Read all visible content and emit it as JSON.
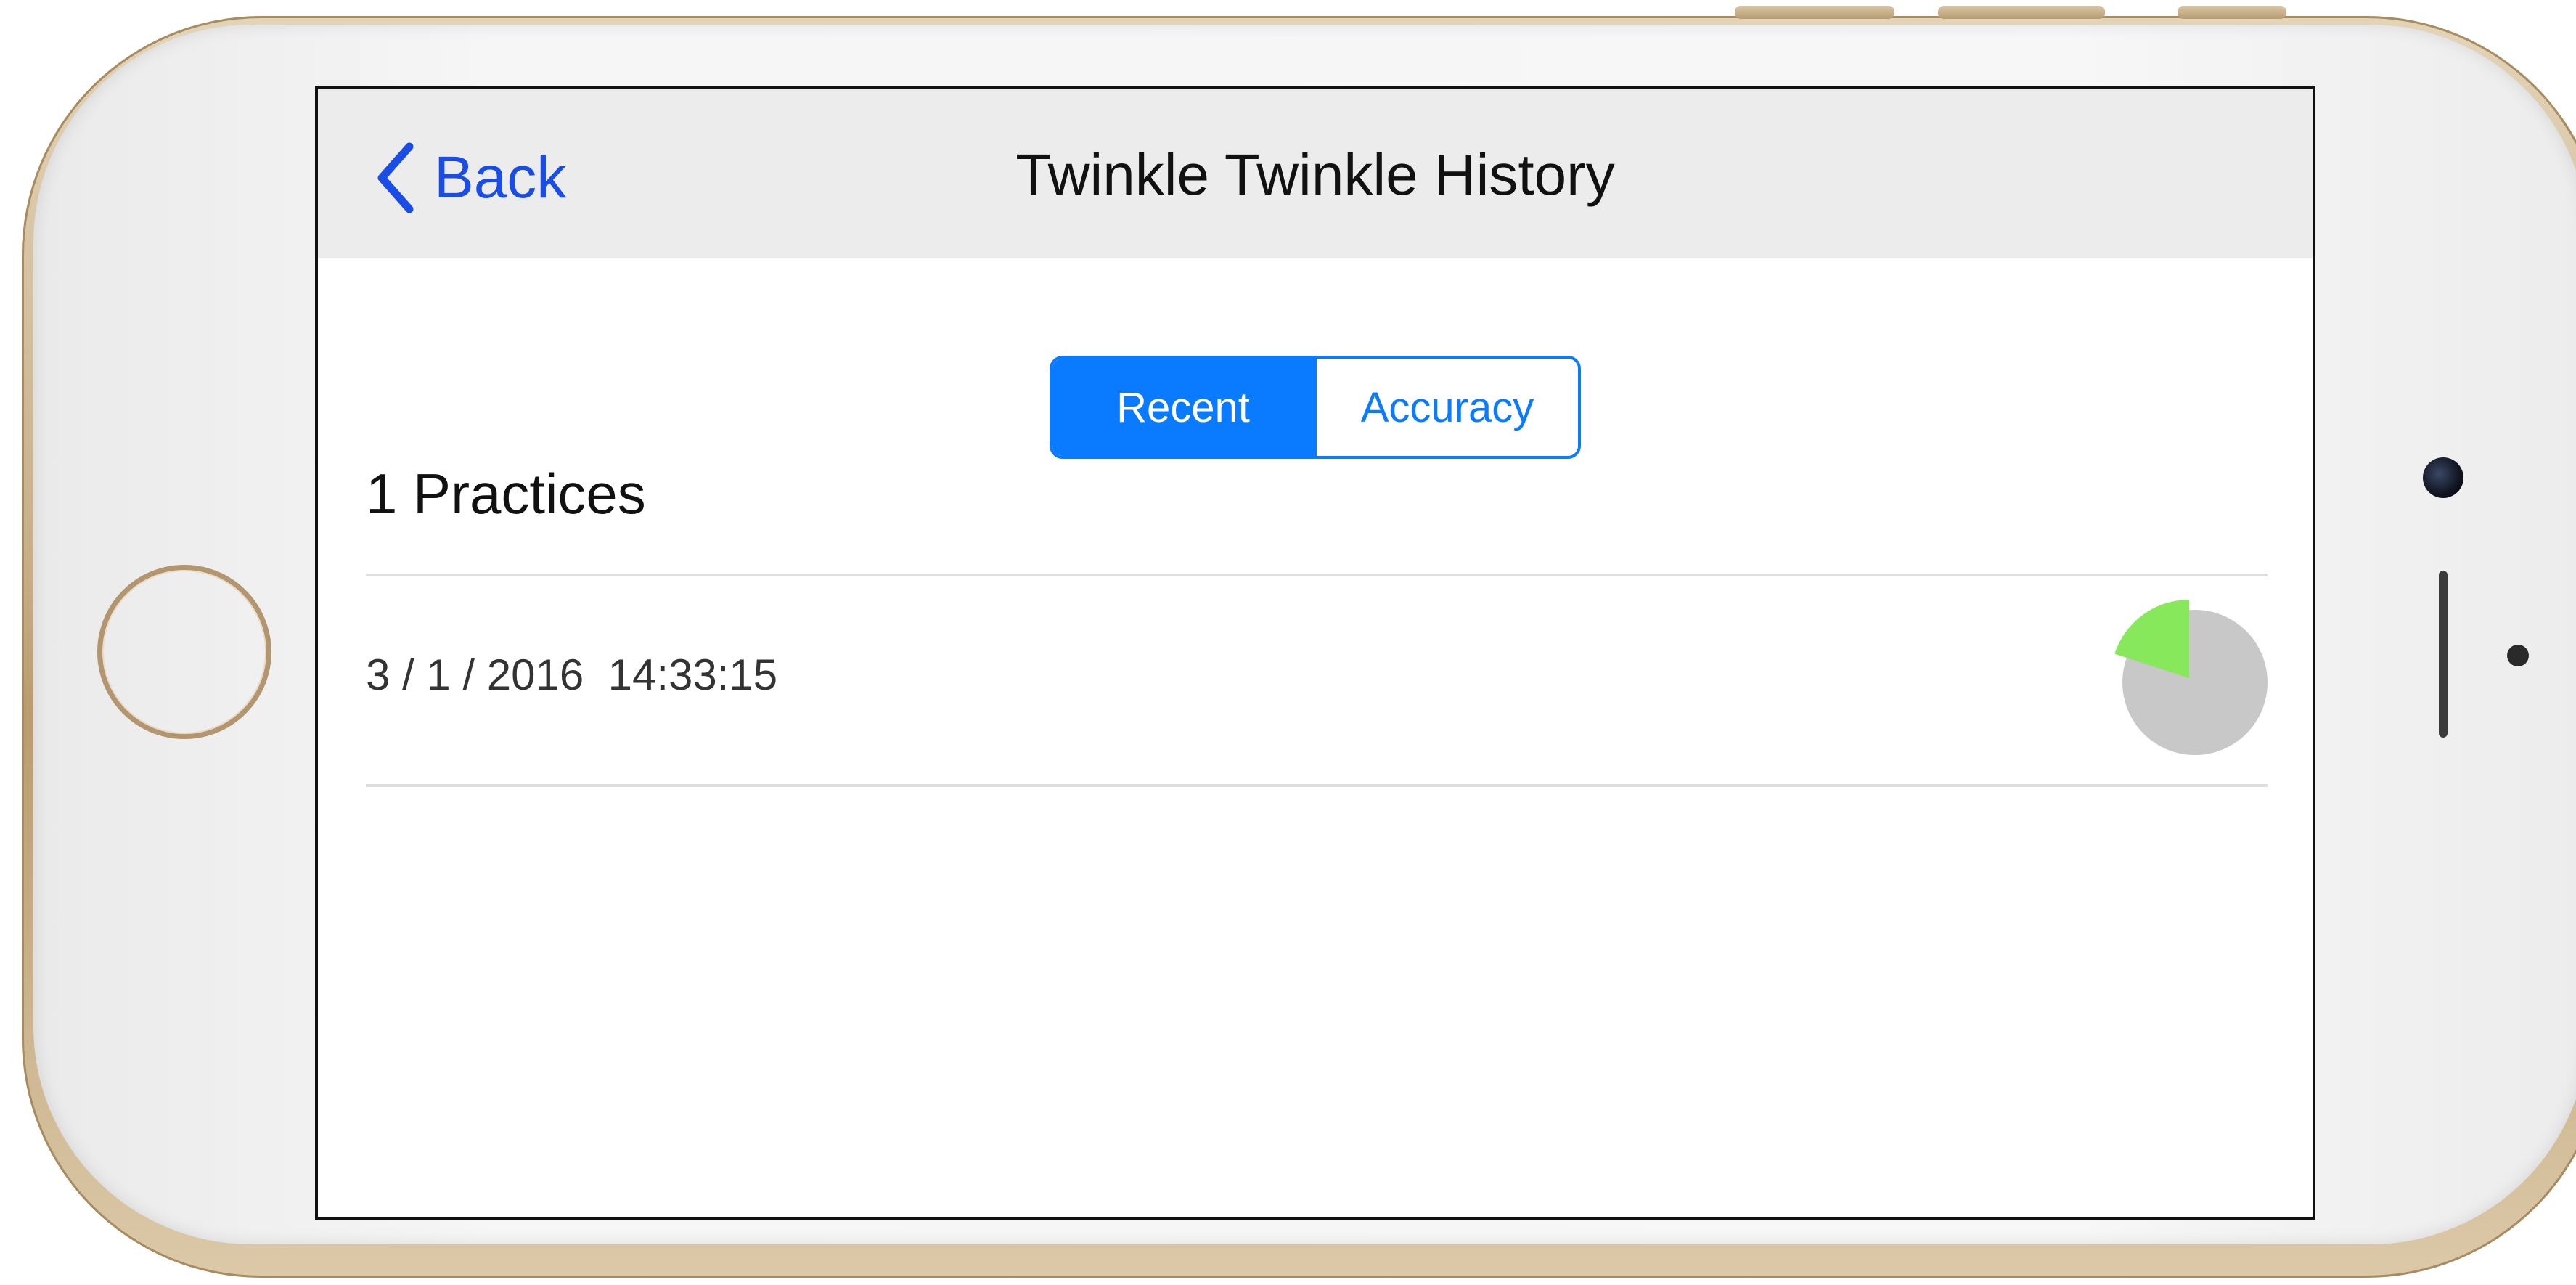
{
  "nav": {
    "back_label": "Back",
    "title": "Twinkle Twinkle History"
  },
  "segments": {
    "recent_label": "Recent",
    "accuracy_label": "Accuracy",
    "selected": "Recent"
  },
  "summary": {
    "title": "1 Practices"
  },
  "practices": [
    {
      "datetime": "3 / 1 / 2016  14:33:15",
      "accuracy_fraction": 0.2,
      "accuracy_color": "#86e85a"
    }
  ],
  "colors": {
    "accent": "#0a7aff",
    "back_link": "#1a4de6",
    "pie_remaining": "#c8c8c8",
    "nav_bar_bg": "#ececec"
  },
  "icons": {
    "back": "chevron-left-icon",
    "home_button": "home-button",
    "camera": "front-camera"
  }
}
